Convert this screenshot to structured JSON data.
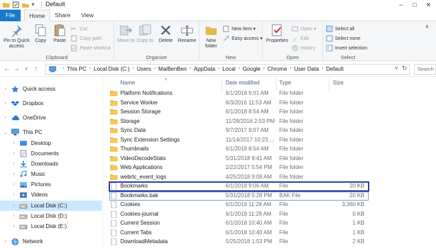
{
  "window": {
    "title": "Default",
    "controls": [
      "–",
      "□",
      "✕"
    ]
  },
  "ribbon_tabs": [
    "File",
    "Home",
    "Share",
    "View"
  ],
  "ribbon": {
    "clipboard": {
      "group_label": "Clipboard",
      "pin_label": "Pin to Quick access",
      "copy_label": "Copy",
      "paste_label": "Paste",
      "cut_label": "Cut",
      "copy_path_label": "Copy path",
      "paste_shortcut_label": "Paste shortcut"
    },
    "organize": {
      "group_label": "Organize",
      "move_to_label": "Move to",
      "copy_to_label": "Copy to",
      "delete_label": "Delete",
      "rename_label": "Rename"
    },
    "new": {
      "group_label": "New",
      "new_folder_label": "New folder",
      "new_item_label": "New item ▾",
      "easy_access_label": "Easy access ▾"
    },
    "open": {
      "group_label": "Open",
      "properties_label": "Properties",
      "open_label": "Open ▾",
      "edit_label": "Edit",
      "history_label": "History"
    },
    "select": {
      "group_label": "Select",
      "select_all_label": "Select all",
      "select_none_label": "Select none",
      "invert_label": "Invert selection"
    }
  },
  "address": {
    "crumbs": [
      "This PC",
      "Local Disk (C:)",
      "Users",
      "MaiBenBen",
      "AppData",
      "Local",
      "Google",
      "Chrome",
      "User Data",
      "Default"
    ],
    "search_placeholder": "Search"
  },
  "nav": {
    "items": [
      {
        "label": "Quick access",
        "icon": "star-icon"
      },
      {
        "label": "Dropbox",
        "icon": "dropbox-icon"
      },
      {
        "label": "OneDrive",
        "icon": "cloud-icon"
      },
      {
        "label": "This PC",
        "icon": "computer-icon"
      },
      {
        "label": "Desktop",
        "icon": "desktop-folder-icon"
      },
      {
        "label": "Documents",
        "icon": "documents-folder-icon"
      },
      {
        "label": "Downloads",
        "icon": "downloads-folder-icon"
      },
      {
        "label": "Music",
        "icon": "music-folder-icon"
      },
      {
        "label": "Pictures",
        "icon": "pictures-folder-icon"
      },
      {
        "label": "Videos",
        "icon": "videos-folder-icon"
      },
      {
        "label": "Local Disk (C:)",
        "icon": "drive-icon"
      },
      {
        "label": "Local Disk (D:)",
        "icon": "drive-icon"
      },
      {
        "label": "Local Disk (E:)",
        "icon": "drive-icon"
      },
      {
        "label": "Network",
        "icon": "network-icon"
      }
    ]
  },
  "columns": {
    "name": "Name",
    "date": "Date modified",
    "type": "Type",
    "size": "Size"
  },
  "files": [
    {
      "name": "Platform Notifications",
      "date": "6/1/2018 9:01 AM",
      "type": "File folder",
      "size": "",
      "kind": "folder"
    },
    {
      "name": "Service Worker",
      "date": "6/3/2016 11:53 AM",
      "type": "File folder",
      "size": "",
      "kind": "folder"
    },
    {
      "name": "Session Storage",
      "date": "6/1/2018 8:54 AM",
      "type": "File folder",
      "size": "",
      "kind": "folder"
    },
    {
      "name": "Storage",
      "date": "11/28/2016 2:53 PM",
      "type": "File folder",
      "size": "",
      "kind": "folder"
    },
    {
      "name": "Sync Data",
      "date": "9/7/2017 9:07 AM",
      "type": "File folder",
      "size": "",
      "kind": "folder"
    },
    {
      "name": "Sync Extension Settings",
      "date": "11/14/2017 10:23 ...",
      "type": "File folder",
      "size": "",
      "kind": "folder"
    },
    {
      "name": "Thumbnails",
      "date": "6/1/2018 8:54 AM",
      "type": "File folder",
      "size": "",
      "kind": "folder"
    },
    {
      "name": "VideoDecodeStats",
      "date": "5/31/2018 9:41 AM",
      "type": "File folder",
      "size": "",
      "kind": "folder"
    },
    {
      "name": "Web Applications",
      "date": "2/22/2017 5:54 PM",
      "type": "File folder",
      "size": "",
      "kind": "folder"
    },
    {
      "name": "webrtc_event_logs",
      "date": "4/25/2018 9:09 AM",
      "type": "File folder",
      "size": "",
      "kind": "folder"
    },
    {
      "name": "Bookmarks",
      "date": "6/1/2018 9:06 AM",
      "type": "File",
      "size": "20 KB",
      "kind": "file"
    },
    {
      "name": "Bookmarks.bak",
      "date": "5/31/2018 5:28 PM",
      "type": "BAK File",
      "size": "20 KB",
      "kind": "file"
    },
    {
      "name": "Cookies",
      "date": "6/1/2018 11:28 AM",
      "type": "File",
      "size": "3,360 KB",
      "kind": "file"
    },
    {
      "name": "Cookies-journal",
      "date": "6/1/2018 11:28 AM",
      "type": "File",
      "size": "0 KB",
      "kind": "file"
    },
    {
      "name": "Current Session",
      "date": "6/1/2018 10:40 AM",
      "type": "File",
      "size": "1 KB",
      "kind": "file"
    },
    {
      "name": "Current Tabs",
      "date": "6/1/2018 10:40 AM",
      "type": "File",
      "size": "1 KB",
      "kind": "file"
    },
    {
      "name": "DownloadMetadata",
      "date": "5/25/2018 1:53 PM",
      "type": "File",
      "size": "2 KB",
      "kind": "file"
    }
  ],
  "colors": {
    "accent": "#1979ca",
    "selection": "#cce8ff",
    "highlight_box": "#2d3aa1",
    "folder": "#e8b94a"
  }
}
